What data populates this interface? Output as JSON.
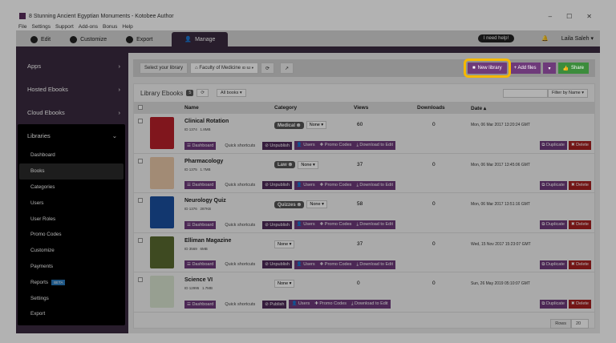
{
  "window": {
    "title": "8 Stunning Ancient Egyptian Monuments - Kotobee Author",
    "controls": [
      "–",
      "☐",
      "✕"
    ]
  },
  "menu": [
    "File",
    "Settings",
    "Support",
    "Add-ons",
    "Bonus",
    "Help"
  ],
  "tabs": [
    {
      "label": "Edit",
      "icon": "pencil-icon"
    },
    {
      "label": "Customize",
      "icon": "brush-icon"
    },
    {
      "label": "Export",
      "icon": "export-icon"
    },
    {
      "label": "Manage",
      "icon": "user-icon"
    }
  ],
  "header": {
    "help": "I need help!",
    "user": "Laila Saleh ▾"
  },
  "sidebar": {
    "items": [
      "Apps",
      "Hosted Ebooks",
      "Cloud Ebooks"
    ],
    "libraries": "Libraries",
    "sub": [
      "Dashboard",
      "Books",
      "Categories",
      "Users",
      "User Roles",
      "Promo Codes",
      "Customize",
      "Payments",
      "Reports",
      "Settings",
      "Export"
    ],
    "beta": "BETA",
    "active": "Books"
  },
  "toolbar": {
    "select_label": "Select your library",
    "library": "Faculty of Medicine",
    "library_id": "ID 52 ▾",
    "new_library": "New library",
    "add_files": "+ Add files",
    "share": "Share"
  },
  "panel": {
    "title": "Library Ebooks",
    "count": "5",
    "filter_all": "All books ▾",
    "filter_by": "Filter by Name ▾",
    "rows_label": "Rows",
    "rows_value": "20"
  },
  "columns": {
    "name": "Name",
    "category": "Category",
    "views": "Views",
    "downloads": "Downloads",
    "date": "Date ▴"
  },
  "labels": {
    "dashboard": "☰ Dashboard",
    "quick": "Quick shortcuts",
    "users": "Users",
    "promo": "Promo Codes",
    "download": "Download to Edit",
    "duplicate": "Duplicate",
    "delete": "Delete",
    "none": "None ▾"
  },
  "books": [
    {
      "name": "Clinical Rotation",
      "id": "ID 1374",
      "size": "1.8MB",
      "category": "Medical",
      "views": "60",
      "downloads": "0",
      "date": "Mon, 06 Mar 2017 13:20:24 GMT",
      "publish": "Unpublish",
      "cover": "#b8202a"
    },
    {
      "name": "Pharmacology",
      "id": "ID 1375",
      "size": "1.7MB",
      "category": "Law",
      "views": "37",
      "downloads": "0",
      "date": "Mon, 06 Mar 2017 13:45:06 GMT",
      "publish": "Unpublish",
      "cover": "#e9c7a8"
    },
    {
      "name": "Neurology Quiz",
      "id": "ID 1376",
      "size": "287KB",
      "category": "Quizzes",
      "views": "58",
      "downloads": "0",
      "date": "Mon, 06 Mar 2017 13:51:16 GMT",
      "publish": "Unpublish",
      "cover": "#1a4fa0"
    },
    {
      "name": "Elliman Magazine",
      "id": "ID 3569",
      "size": "6MB",
      "category": "",
      "views": "37",
      "downloads": "0",
      "date": "Wed, 15 Nov 2017 15:23:07 GMT",
      "publish": "Unpublish",
      "cover": "#5a6a30"
    },
    {
      "name": "Science VI",
      "id": "ID 12995",
      "size": "1.7MB",
      "category": "",
      "views": "0",
      "downloads": "0",
      "date": "Sun, 26 May 2019 05:10:07 GMT",
      "publish": "Publish",
      "cover": "#d8e4d0"
    }
  ]
}
